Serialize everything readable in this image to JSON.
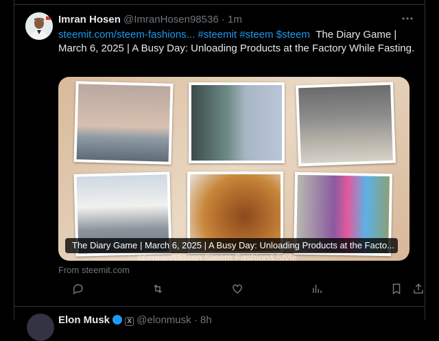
{
  "tweet": {
    "author_name": "Imran Hosen",
    "author_handle": "@ImranHosen98536",
    "separator": "·",
    "time": "1m",
    "link_text": "steemit.com/steem-fashions...",
    "hashtags": [
      "#steemit",
      "#steem",
      "$steem"
    ],
    "body_text": "The Diary Game | March 6, 2025 | A Busy Day: Unloading Products at the Factory While Fasting.",
    "card": {
      "caption": "The Diary Game | March 6, 2025 | A Busy Day: Unloading Products at the Facto...",
      "watermark": "@imranhassan Steem Fashion&Style"
    },
    "source": "From steemit.com",
    "actions": [
      "reply-icon",
      "retweet-icon",
      "like-icon",
      "views-icon",
      "bookmark-icon",
      "share-icon"
    ]
  },
  "next_tweet": {
    "author_name": "Elon Musk",
    "badge": "X",
    "author_handle": "@elonmusk",
    "time": "8h"
  },
  "colors": {
    "background": "#000000",
    "text": "#e7e9ea",
    "secondary": "#71767b",
    "link": "#1d9bf0",
    "border": "#2f3336"
  }
}
